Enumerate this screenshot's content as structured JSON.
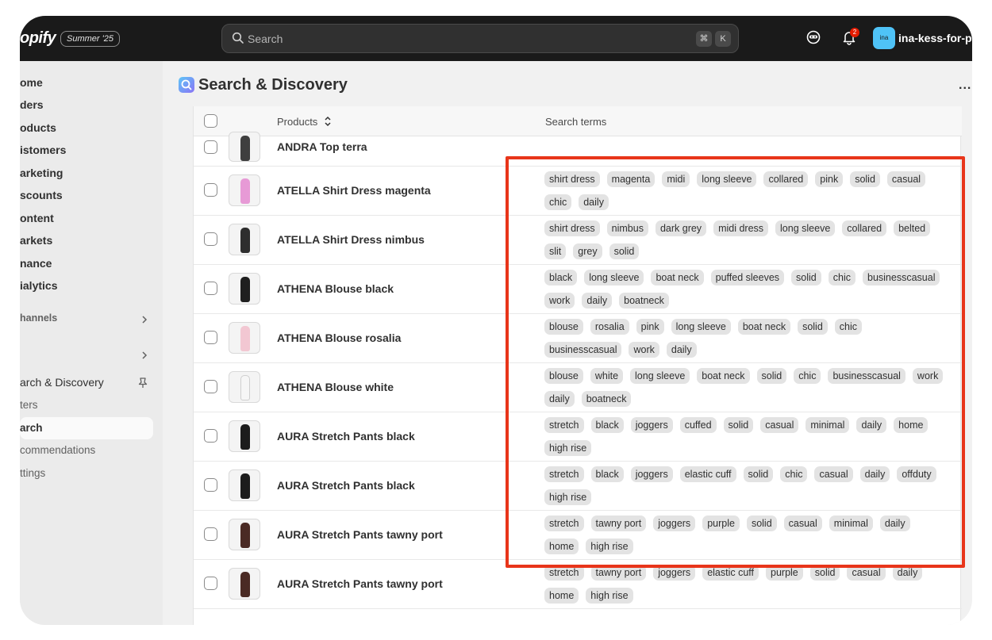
{
  "header": {
    "logo_text": "opify",
    "version_badge": "Summer '25",
    "search_placeholder": "Search",
    "shortcut_keys": [
      "⌘",
      "K"
    ],
    "notification_count": "2",
    "store_avatar": "ina",
    "store_name": "ina-kess-for-po"
  },
  "sidebar": {
    "items": [
      {
        "label": "ome"
      },
      {
        "label": "ders"
      },
      {
        "label": "oducts"
      },
      {
        "label": "istomers"
      },
      {
        "label": "arketing"
      },
      {
        "label": "scounts"
      },
      {
        "label": "ontent"
      },
      {
        "label": "arkets"
      },
      {
        "label": "nance"
      },
      {
        "label": "ialytics"
      }
    ],
    "channels_label": "hannels",
    "app_name": "arch & Discovery",
    "app_subitems": [
      {
        "label": "ters"
      },
      {
        "label": "arch"
      },
      {
        "label": "commendations"
      },
      {
        "label": "ttings"
      }
    ]
  },
  "page": {
    "title": "Search & Discovery",
    "more_label": "..."
  },
  "table": {
    "columns": {
      "products": "Products",
      "search_terms": "Search terms"
    },
    "rows": [
      {
        "name": "ANDRA Top terra",
        "tags": []
      },
      {
        "name": "ATELLA Shirt Dress magenta",
        "tags": [
          "shirt dress",
          "magenta",
          "midi",
          "long sleeve",
          "collared",
          "pink",
          "solid",
          "casual",
          "chic",
          "daily"
        ]
      },
      {
        "name": "ATELLA Shirt Dress nimbus",
        "tags": [
          "shirt dress",
          "nimbus",
          "dark grey",
          "midi dress",
          "long sleeve",
          "collared",
          "belted",
          "slit",
          "grey",
          "solid"
        ]
      },
      {
        "name": "ATHENA Blouse black",
        "tags": [
          "black",
          "long sleeve",
          "boat neck",
          "puffed sleeves",
          "solid",
          "chic",
          "businesscasual",
          "work",
          "daily",
          "boatneck"
        ]
      },
      {
        "name": "ATHENA Blouse rosalia",
        "tags": [
          "blouse",
          "rosalia",
          "pink",
          "long sleeve",
          "boat neck",
          "solid",
          "chic",
          "businesscasual",
          "work",
          "daily"
        ]
      },
      {
        "name": "ATHENA Blouse white",
        "tags": [
          "blouse",
          "white",
          "long sleeve",
          "boat neck",
          "solid",
          "chic",
          "businesscasual",
          "work",
          "daily",
          "boatneck"
        ]
      },
      {
        "name": "AURA Stretch Pants black",
        "tags": [
          "stretch",
          "black",
          "joggers",
          "cuffed",
          "solid",
          "casual",
          "minimal",
          "daily",
          "home",
          "high rise"
        ]
      },
      {
        "name": "AURA Stretch Pants black",
        "tags": [
          "stretch",
          "black",
          "joggers",
          "elastic cuff",
          "solid",
          "chic",
          "casual",
          "daily",
          "offduty",
          "high rise"
        ]
      },
      {
        "name": "AURA Stretch Pants tawny port",
        "tags": [
          "stretch",
          "tawny port",
          "joggers",
          "purple",
          "solid",
          "casual",
          "minimal",
          "daily",
          "home",
          "high rise"
        ]
      },
      {
        "name": "AURA Stretch Pants tawny port",
        "tags": [
          "stretch",
          "tawny port",
          "joggers",
          "elastic cuff",
          "purple",
          "solid",
          "casual",
          "daily",
          "home",
          "high rise"
        ]
      }
    ]
  },
  "colors": {
    "topbar": "#1a1a1a",
    "highlight_border": "#e8351a",
    "tag_bg": "#e3e3e3",
    "notification_badge": "#e51c00",
    "store_avatar": "#4fc3f7"
  }
}
